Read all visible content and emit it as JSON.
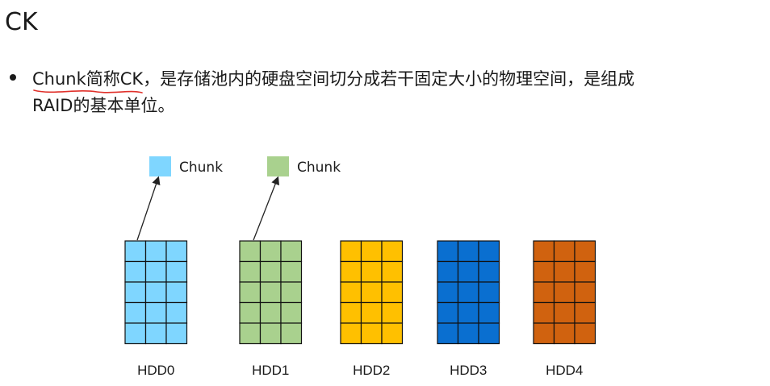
{
  "title": "CK",
  "bullet": {
    "line1": "Chunk简称CK，是存储池内的硬盘空间切分成若干固定大小的物理空间，是组成",
    "line2": "RAID的基本单位。"
  },
  "legend": [
    {
      "label": "Chunk",
      "color": "#7fd6ff"
    },
    {
      "label": "Chunk",
      "color": "#a9d18e"
    }
  ],
  "disks": [
    {
      "label": "HDD0",
      "color": "#7fd6ff"
    },
    {
      "label": "HDD1",
      "color": "#a9d18e"
    },
    {
      "label": "HDD2",
      "color": "#ffc000"
    },
    {
      "label": "HDD3",
      "color": "#0a6fd0"
    },
    {
      "label": "HDD4",
      "color": "#d0620f"
    }
  ],
  "annotation_color": "#e0302a"
}
